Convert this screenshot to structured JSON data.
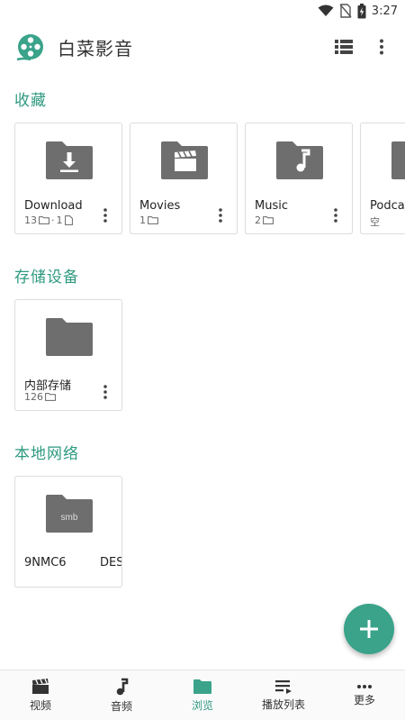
{
  "status_bar": {
    "time": "3:27",
    "icons": [
      "wifi-icon",
      "no-sim-icon",
      "battery-charging-icon"
    ]
  },
  "app_bar": {
    "title": "白菜影音",
    "logo": "film-reel-logo",
    "actions": [
      "list-view-icon",
      "more-vert-icon"
    ]
  },
  "sections": {
    "favorites": {
      "title": "收藏",
      "items": [
        {
          "name": "Download",
          "folder_icon": "download-folder-icon",
          "folders": "13",
          "files": "1"
        },
        {
          "name": "Movies",
          "folder_icon": "movies-folder-icon",
          "folders": "1"
        },
        {
          "name": "Music",
          "folder_icon": "music-folder-icon",
          "folders": "2"
        },
        {
          "name": "Podcasts",
          "folder_icon": "podcasts-folder-icon",
          "empty_label": "空"
        }
      ]
    },
    "storage": {
      "title": "存储设备",
      "items": [
        {
          "name": "内部存储",
          "folders": "126"
        }
      ]
    },
    "network": {
      "title": "本地网络",
      "items": [
        {
          "badge": "smb",
          "name_left": "9NMC6",
          "name_right": "DESKTOP"
        }
      ]
    }
  },
  "bottom_nav": {
    "items": [
      {
        "label": "视频",
        "icon": "clapperboard-icon"
      },
      {
        "label": "音频",
        "icon": "music-note-icon"
      },
      {
        "label": "浏览",
        "icon": "folder-icon",
        "active": true
      },
      {
        "label": "播放列表",
        "icon": "playlist-icon"
      },
      {
        "label": "更多",
        "icon": "more-horiz-icon"
      }
    ]
  },
  "colors": {
    "accent": "#3aa38a",
    "section_title": "#2f9a80",
    "folder": "#6e6e6e"
  }
}
